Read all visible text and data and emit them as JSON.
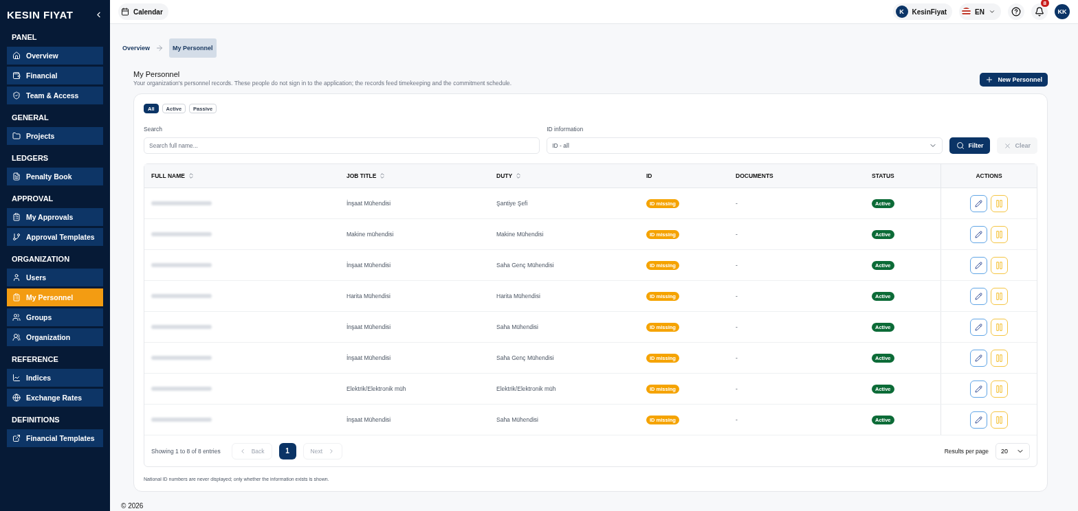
{
  "sidebar": {
    "logo": "KESIN FIYAT",
    "sections": [
      {
        "title": "PANEL",
        "items": [
          {
            "label": "Overview",
            "selected": false
          },
          {
            "label": "Financial",
            "selected": false
          },
          {
            "label": "Team & Access",
            "selected": false
          }
        ]
      },
      {
        "title": "GENERAL",
        "items": [
          {
            "label": "Projects",
            "selected": false
          }
        ]
      },
      {
        "title": "LEDGERS",
        "items": [
          {
            "label": "Penalty Book",
            "selected": false
          }
        ]
      },
      {
        "title": "APPROVAL",
        "items": [
          {
            "label": "My Approvals",
            "selected": false
          },
          {
            "label": "Approval Templates",
            "selected": false
          }
        ]
      },
      {
        "title": "ORGANIZATION",
        "items": [
          {
            "label": "Users",
            "selected": false
          },
          {
            "label": "My Personnel",
            "selected": true
          },
          {
            "label": "Groups",
            "selected": false
          },
          {
            "label": "Organization",
            "selected": false
          }
        ]
      },
      {
        "title": "REFERENCE",
        "items": [
          {
            "label": "Indices",
            "selected": false
          },
          {
            "label": "Exchange Rates",
            "selected": false
          }
        ]
      },
      {
        "title": "DEFINITIONS",
        "items": [
          {
            "label": "Financial Templates",
            "selected": false
          }
        ]
      }
    ]
  },
  "topbar": {
    "calendar": "Calendar",
    "company_initial": "K",
    "company": "KesinFiyat",
    "language": "EN",
    "notifications": "8",
    "user_initials": "KK"
  },
  "breadcrumb": [
    {
      "label": "Overview",
      "selected": false
    },
    {
      "label": "My Personnel",
      "selected": true
    }
  ],
  "page": {
    "title": "My Personnel",
    "subtitle": "Your organization's personnel records. These people do not sign in to the application; the records feed timekeeping and the commitment schedule.",
    "new_button": "New Personnel"
  },
  "filters": {
    "chips": [
      {
        "label": "All",
        "selected": true
      },
      {
        "label": "Active",
        "selected": false
      },
      {
        "label": "Passive",
        "selected": false
      }
    ],
    "search_label": "Search",
    "search_placeholder": "Search full name...",
    "id_label": "ID information",
    "id_value": "ID - all",
    "filter_button": "Filter",
    "clear_button": {
      "label": "Clear",
      "disabled": true
    }
  },
  "table": {
    "columns": [
      {
        "label": "FULL NAME",
        "sortable": true
      },
      {
        "label": "JOB TITLE",
        "sortable": true
      },
      {
        "label": "DUTY",
        "sortable": true
      },
      {
        "label": "ID",
        "sortable": false
      },
      {
        "label": "DOCUMENTS",
        "sortable": false
      },
      {
        "label": "STATUS",
        "sortable": false
      },
      {
        "label": "ACTIONS",
        "sortable": false
      }
    ],
    "rows": [
      {
        "job_title": "İnşaat Mühendisi",
        "duty": "Şantiye Şefi",
        "id": "ID missing",
        "documents": "-",
        "status": "Active"
      },
      {
        "job_title": "Makine mühendisi",
        "duty": "Makine Mühendisi",
        "id": "ID missing",
        "documents": "-",
        "status": "Active"
      },
      {
        "job_title": "İnşaat Mühendisi",
        "duty": "Saha Genç Mühendisi",
        "id": "ID missing",
        "documents": "-",
        "status": "Active"
      },
      {
        "job_title": "Harita Mühendisi",
        "duty": "Harita Mühendisi",
        "id": "ID missing",
        "documents": "-",
        "status": "Active"
      },
      {
        "job_title": "İnşaat Mühendisi",
        "duty": "Saha Mühendisi",
        "id": "ID missing",
        "documents": "-",
        "status": "Active"
      },
      {
        "job_title": "İnşaat Mühendisi",
        "duty": "Saha Genç Mühendisi",
        "id": "ID missing",
        "documents": "-",
        "status": "Active"
      },
      {
        "job_title": "Elektrik/Elektronik müh",
        "duty": "Elektrik/Elektronik müh",
        "id": "ID missing",
        "documents": "-",
        "status": "Active"
      },
      {
        "job_title": "İnşaat Mühendisi",
        "duty": "Saha Mühendisi",
        "id": "ID missing",
        "documents": "-",
        "status": "Active"
      }
    ]
  },
  "pagination": {
    "summary": "Showing 1 to 8 of 8 entries",
    "back": {
      "label": "Back",
      "disabled": true
    },
    "pages": [
      {
        "label": "1",
        "selected": true
      }
    ],
    "next": {
      "label": "Next",
      "disabled": true
    },
    "per_page_label": "Results per page",
    "per_page": "20"
  },
  "note": "National ID numbers are never displayed; only whether the information exists is shown.",
  "footer": "© 2026"
}
